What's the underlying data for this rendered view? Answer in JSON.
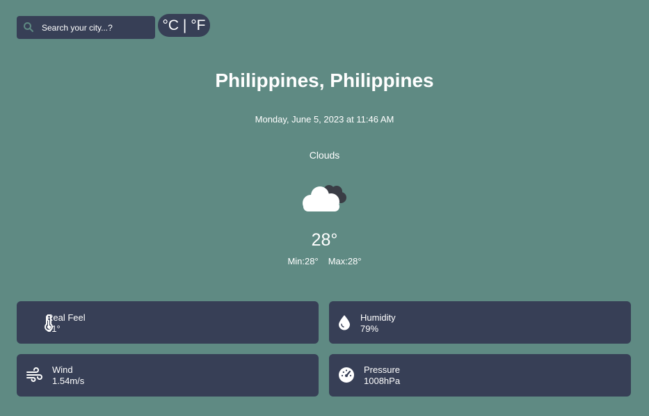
{
  "search": {
    "placeholder": "Search your city...?"
  },
  "units": {
    "toggle_label": "°C | °F"
  },
  "location": {
    "city": "Philippines, Philippines"
  },
  "current": {
    "datetime": "Monday, June 5, 2023 at 11:46 AM",
    "condition": "Clouds",
    "icon": "cloud-icon",
    "temperature": "28°",
    "min": "Min:28°",
    "max": "Max:28°"
  },
  "details": {
    "real_feel": {
      "label": "Real Feel",
      "value": "31°",
      "icon": "thermometer-icon"
    },
    "humidity": {
      "label": "Humidity",
      "value": "79%",
      "icon": "droplet-icon"
    },
    "wind": {
      "label": "Wind",
      "value": "1.54m/s",
      "icon": "wind-icon"
    },
    "pressure": {
      "label": "Pressure",
      "value": "1008hPa",
      "icon": "gauge-icon"
    }
  },
  "colors": {
    "background": "#5f8a83",
    "card": "#373f56",
    "text": "#ffffff"
  }
}
